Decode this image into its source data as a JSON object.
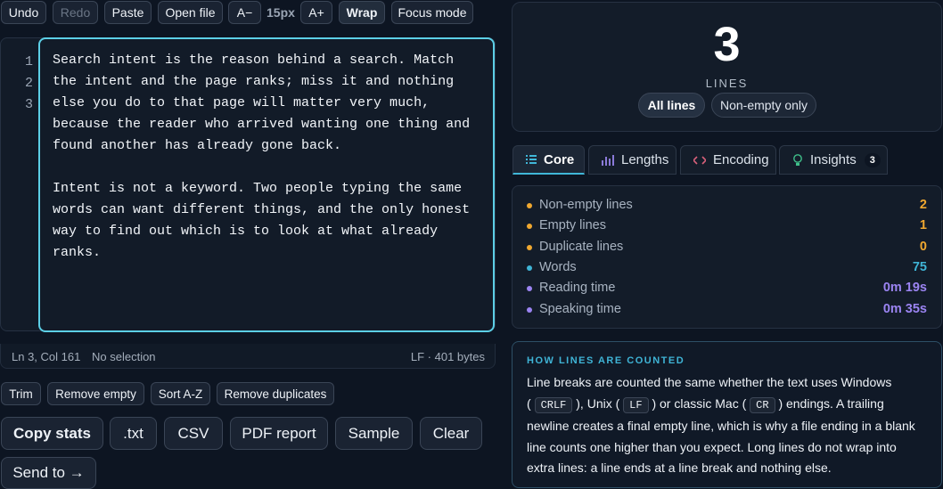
{
  "toolbar": {
    "undo": "Undo",
    "redo": "Redo",
    "paste": "Paste",
    "open_file": "Open file",
    "font_decrease": "A−",
    "font_size": "15px",
    "font_increase": "A+",
    "wrap": "Wrap",
    "focus_mode": "Focus mode"
  },
  "editor": {
    "line_numbers": [
      "1",
      "2",
      "3"
    ],
    "text": "Search intent is the reason behind a search. Match\nthe intent and the page ranks; miss it and nothing\nelse you do to that page will matter very much,\nbecause the reader who arrived wanting one thing and\nfound another has already gone back.\n\nIntent is not a keyword. Two people typing the same\nwords can want different things, and the only honest\nway to find out which is to look at what already\nranks."
  },
  "status": {
    "cursor": "Ln 3, Col 161",
    "selection": "No selection",
    "encoding": "LF · 401 bytes"
  },
  "actions": {
    "trim": "Trim",
    "remove_empty": "Remove empty",
    "sort": "Sort A-Z",
    "remove_duplicates": "Remove duplicates"
  },
  "export": {
    "copy_stats": "Copy stats",
    "txt": ".txt",
    "csv": "CSV",
    "pdf": "PDF report",
    "sample": "Sample",
    "clear": "Clear",
    "send_to": "Send to →"
  },
  "summary": {
    "count": "3",
    "label": "LINES",
    "mode_all": "All lines",
    "mode_nonempty": "Non-empty only"
  },
  "tabs": {
    "core": "Core",
    "lengths": "Lengths",
    "encoding": "Encoding",
    "insights": "Insights",
    "insights_badge": "3"
  },
  "core_stats": [
    {
      "label": "Non-empty lines",
      "value": "2",
      "color": "#f0a830"
    },
    {
      "label": "Empty lines",
      "value": "1",
      "color": "#f0a830"
    },
    {
      "label": "Duplicate lines",
      "value": "0",
      "color": "#f0a830"
    },
    {
      "label": "Words",
      "value": "75",
      "color": "#3fb4d6"
    },
    {
      "label": "Reading time",
      "value": "0m 19s",
      "color": "#9b84f2"
    },
    {
      "label": "Speaking time",
      "value": "0m 35s",
      "color": "#9b84f2"
    }
  ],
  "info": {
    "title": "HOW LINES ARE COUNTED",
    "p1": "Line breaks are counted the same whether the text uses Windows",
    "code_crlf": "CRLF",
    "p2": "), Unix (",
    "code_lf": "LF",
    "p3": ") or classic Mac (",
    "code_cr": "CR",
    "p4": ") endings. A trailing newline creates a final empty line, which is why a file ending in a blank line counts one higher than you expect. Long lines do not wrap into extra lines: a line ends at a line break and nothing else."
  },
  "colors": {
    "accent": "#5ccfe6",
    "amber": "#f0a830",
    "teal": "#3fb4d6",
    "purple": "#9b84f2"
  }
}
